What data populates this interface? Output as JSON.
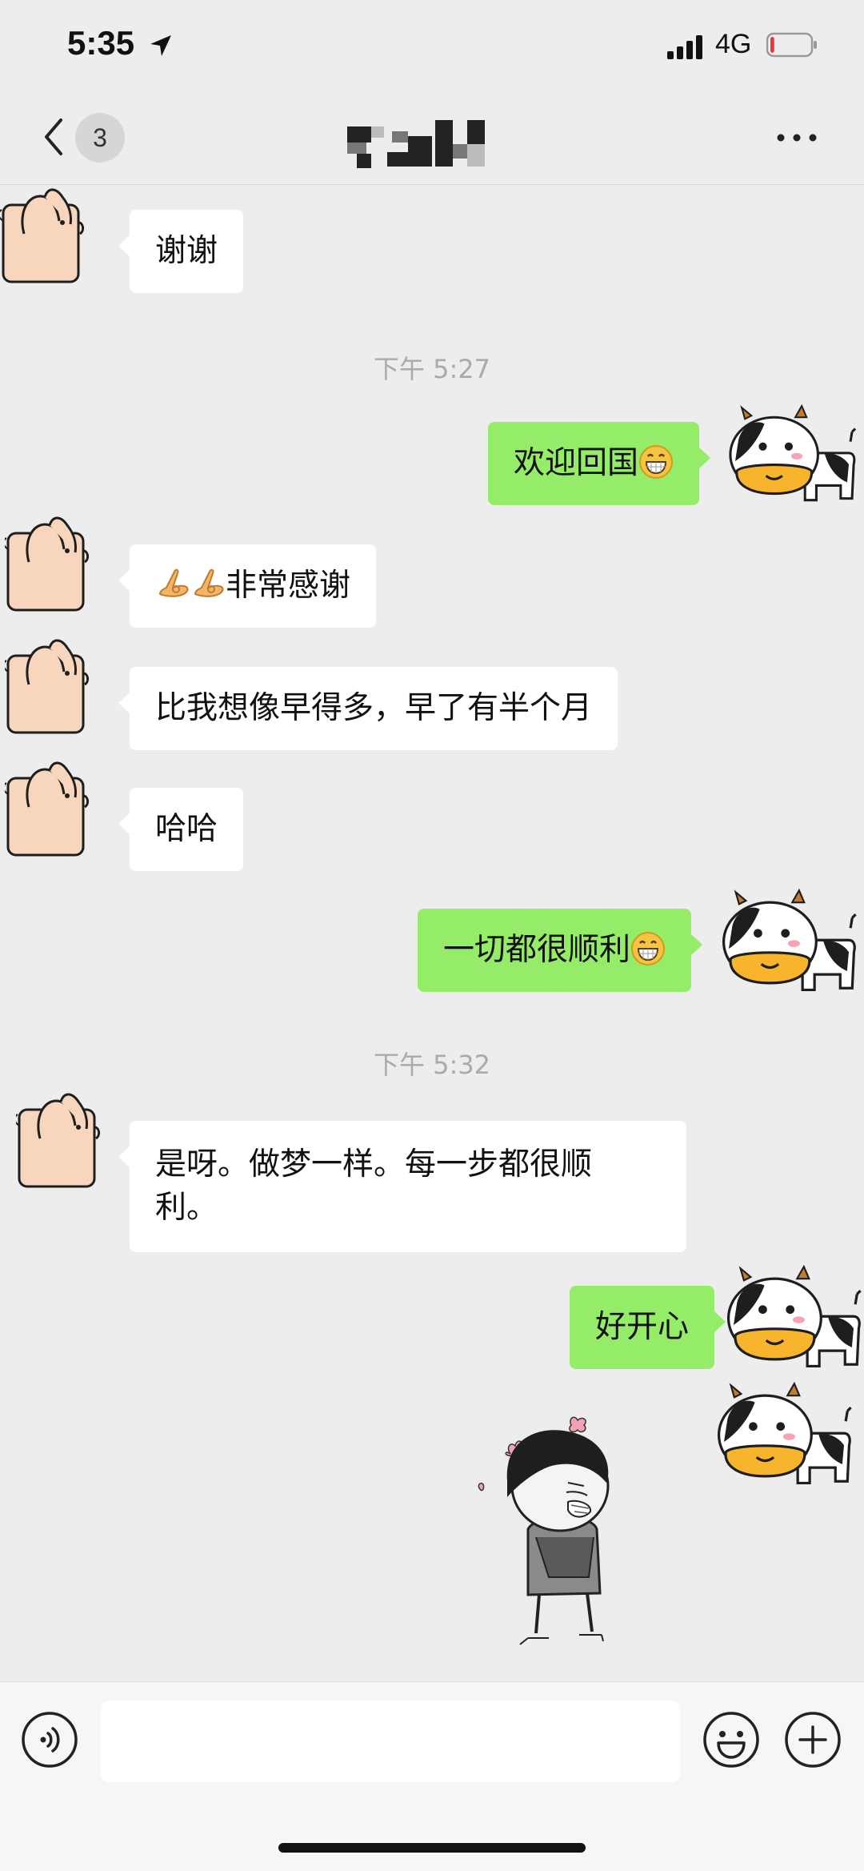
{
  "status_bar": {
    "time": "5:35",
    "network": "4G",
    "battery_level": 0.1
  },
  "nav": {
    "unread_count": "3"
  },
  "messages": [
    {
      "text": "谢谢"
    },
    {
      "text": "欢迎回国"
    },
    {
      "text": "非常感谢"
    },
    {
      "text": "比我想像早得多，早了有半个月"
    },
    {
      "text": "哈哈"
    },
    {
      "text": "一切都很顺利"
    },
    {
      "text_line1": "是呀。做梦一样。每一步都很顺",
      "text_line2": "利。"
    },
    {
      "text": "好开心"
    }
  ],
  "timestamps": [
    "下午 5:27",
    "下午 5:32"
  ],
  "icons": {
    "back": "chevron-left-icon",
    "more": "more-dots-icon",
    "voice": "voice-icon",
    "emoji": "smiley-icon",
    "plus": "plus-icon"
  },
  "colors": {
    "outgoing_bubble": "#95ec69",
    "incoming_bubble": "#ffffff",
    "background": "#ededed"
  }
}
